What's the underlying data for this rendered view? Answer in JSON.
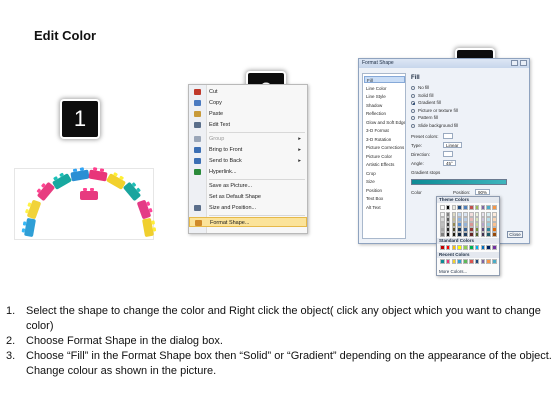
{
  "title": "Edit Color",
  "badges": [
    "1",
    "2",
    "3"
  ],
  "context_menu": {
    "items": [
      {
        "label": "Cut",
        "icon": "scissors-icon",
        "color": "#c0392b",
        "enabled": true,
        "submenu": false
      },
      {
        "label": "Copy",
        "icon": "copy-icon",
        "color": "#4a7ac0",
        "enabled": true,
        "submenu": false
      },
      {
        "label": "Paste",
        "icon": "clipboard-icon",
        "color": "#c89a3a",
        "enabled": true,
        "submenu": false
      },
      {
        "label": "Edit Text",
        "icon": "edit-text-icon",
        "color": "#5a6e8a",
        "enabled": true,
        "submenu": false
      },
      {
        "label": "Group",
        "icon": "group-icon",
        "color": "#9aa6b8",
        "enabled": false,
        "submenu": true
      },
      {
        "label": "Bring to Front",
        "icon": "bring-front-icon",
        "color": "#3c6fb4",
        "enabled": true,
        "submenu": true
      },
      {
        "label": "Send to Back",
        "icon": "send-back-icon",
        "color": "#3c6fb4",
        "enabled": true,
        "submenu": true
      },
      {
        "label": "Hyperlink...",
        "icon": "hyperlink-icon",
        "color": "#2a8a3a",
        "enabled": true,
        "submenu": false
      },
      {
        "label": "Save as Picture...",
        "icon": "",
        "color": "",
        "enabled": true,
        "submenu": false
      },
      {
        "label": "Set as Default Shape",
        "icon": "",
        "color": "",
        "enabled": true,
        "submenu": false
      },
      {
        "label": "Size and Position...",
        "icon": "size-position-icon",
        "color": "#5a6e8a",
        "enabled": true,
        "submenu": false
      },
      {
        "label": "Format Shape...",
        "icon": "format-shape-icon",
        "color": "#d08a2a",
        "enabled": true,
        "submenu": false,
        "highlighted": true
      }
    ]
  },
  "dialog": {
    "title": "Format Shape",
    "nav": [
      "Fill",
      "Line Color",
      "Line Style",
      "Shadow",
      "Reflection",
      "Glow and Soft Edges",
      "3-D Format",
      "3-D Rotation",
      "Picture Corrections",
      "Picture Color",
      "Artistic Effects",
      "Crop",
      "Size",
      "Position",
      "Text Box",
      "Alt Text"
    ],
    "selected_nav": "Fill",
    "fill_heading": "Fill",
    "fill_options": [
      {
        "label": "No fill",
        "checked": false
      },
      {
        "label": "Solid fill",
        "checked": false
      },
      {
        "label": "Gradient fill",
        "checked": true
      },
      {
        "label": "Picture or texture fill",
        "checked": false
      },
      {
        "label": "Pattern fill",
        "checked": false
      },
      {
        "label": "Slide background fill",
        "checked": false
      }
    ],
    "props": [
      {
        "key": "Preset colors:",
        "value": ""
      },
      {
        "key": "Type:",
        "value": "Linear"
      },
      {
        "key": "Direction:",
        "value": ""
      },
      {
        "key": "Angle:",
        "value": "45°"
      },
      {
        "key": "Gradient stops",
        "value": ""
      }
    ],
    "color_label": "Color",
    "position_label": "Position:",
    "position_value": "90%",
    "brightness_label": "Brightness:",
    "transparency_label": "Transparency:",
    "rotate_label": "Rotate",
    "close_label": "Close"
  },
  "palette": {
    "theme_header": "Theme Colors",
    "standard_header": "Standard Colors",
    "recent_header": "Recent Colors",
    "more_label": "More Colors...",
    "theme_top": [
      "#ffffff",
      "#000000",
      "#eeece1",
      "#1f497d",
      "#4f81bd",
      "#c0504d",
      "#9bbb59",
      "#8064a2",
      "#4bacc6",
      "#f79646"
    ],
    "theme_shades": [
      [
        "#f2f2f2",
        "#7f7f7f",
        "#ddd9c3",
        "#c6d9f0",
        "#dbe5f1",
        "#f2dcdb",
        "#ebf1dd",
        "#e5e0ec",
        "#dbeef3",
        "#fdeada"
      ],
      [
        "#d8d8d8",
        "#595959",
        "#c4bd97",
        "#8db3e2",
        "#b8cce4",
        "#e5b9b7",
        "#d7e3bc",
        "#ccc1d9",
        "#b7dde8",
        "#fbd5b5"
      ],
      [
        "#bfbfbf",
        "#3f3f3f",
        "#938953",
        "#548dd4",
        "#95b3d7",
        "#d99694",
        "#c3d69b",
        "#b2a2c7",
        "#92cddc",
        "#fac08f"
      ],
      [
        "#a5a5a5",
        "#262626",
        "#494429",
        "#17365d",
        "#366092",
        "#953734",
        "#76923c",
        "#5f497a",
        "#31859b",
        "#e36c09"
      ],
      [
        "#7f7f7f",
        "#0c0c0c",
        "#1d1b10",
        "#0f243e",
        "#244061",
        "#632423",
        "#4f6128",
        "#3f3151",
        "#205867",
        "#974806"
      ]
    ],
    "standard": [
      "#c00000",
      "#ff0000",
      "#ffc000",
      "#ffff00",
      "#92d050",
      "#00b050",
      "#00b0f0",
      "#0070c0",
      "#002060",
      "#7030a0"
    ],
    "recent": [
      "#0d8b95",
      "#e8357a",
      "#f2d12c",
      "#2f9fd6",
      "#5cb85c",
      "#d9534f",
      "#1f497d",
      "#8064a2",
      "#f79646",
      "#4bacc6"
    ]
  },
  "blocks": {
    "colors": [
      "#f1d33a",
      "#e83c80",
      "#18a8a0",
      "#2b8fd4",
      "#e8357a",
      "#f2d12c",
      "#1aa59e",
      "#e43b86",
      "#2f9fd6",
      "#f0cf2e",
      "#e73a7f"
    ]
  },
  "steps": [
    {
      "num": "1.",
      "text": "Select the shape to change the color and Right click the object( click any object which you want to change color)"
    },
    {
      "num": "2.",
      "text": "Choose Format Shape in the dialog box."
    },
    {
      "num": "3.",
      "text": "Choose “Fill” in the Format Shape box then “Solid” or “Gradient” depending on the appearance of the object. Change colour as shown in the picture."
    }
  ]
}
